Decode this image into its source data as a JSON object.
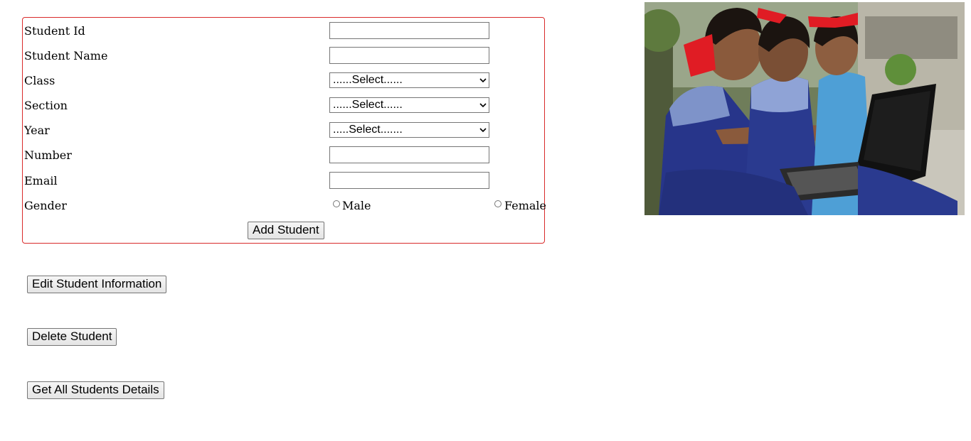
{
  "form": {
    "fields": [
      {
        "label": "Student Id",
        "type": "text",
        "value": ""
      },
      {
        "label": "Student Name",
        "type": "text",
        "value": ""
      },
      {
        "label": "Class",
        "type": "select",
        "selected": "......Select......"
      },
      {
        "label": "Section",
        "type": "select",
        "selected": "......Select......"
      },
      {
        "label": "Year",
        "type": "select",
        "selected": ".....Select......."
      },
      {
        "label": "Number",
        "type": "text",
        "value": ""
      },
      {
        "label": "Email",
        "type": "text",
        "value": ""
      }
    ],
    "gender": {
      "label": "Gender",
      "options": [
        "Male",
        "Female"
      ]
    },
    "submit_label": "Add Student"
  },
  "actions": {
    "edit_label": "Edit Student Information",
    "delete_label": "Delete Student",
    "get_all_label": "Get All Students Details"
  },
  "colors": {
    "form_border": "#d92b2b"
  }
}
